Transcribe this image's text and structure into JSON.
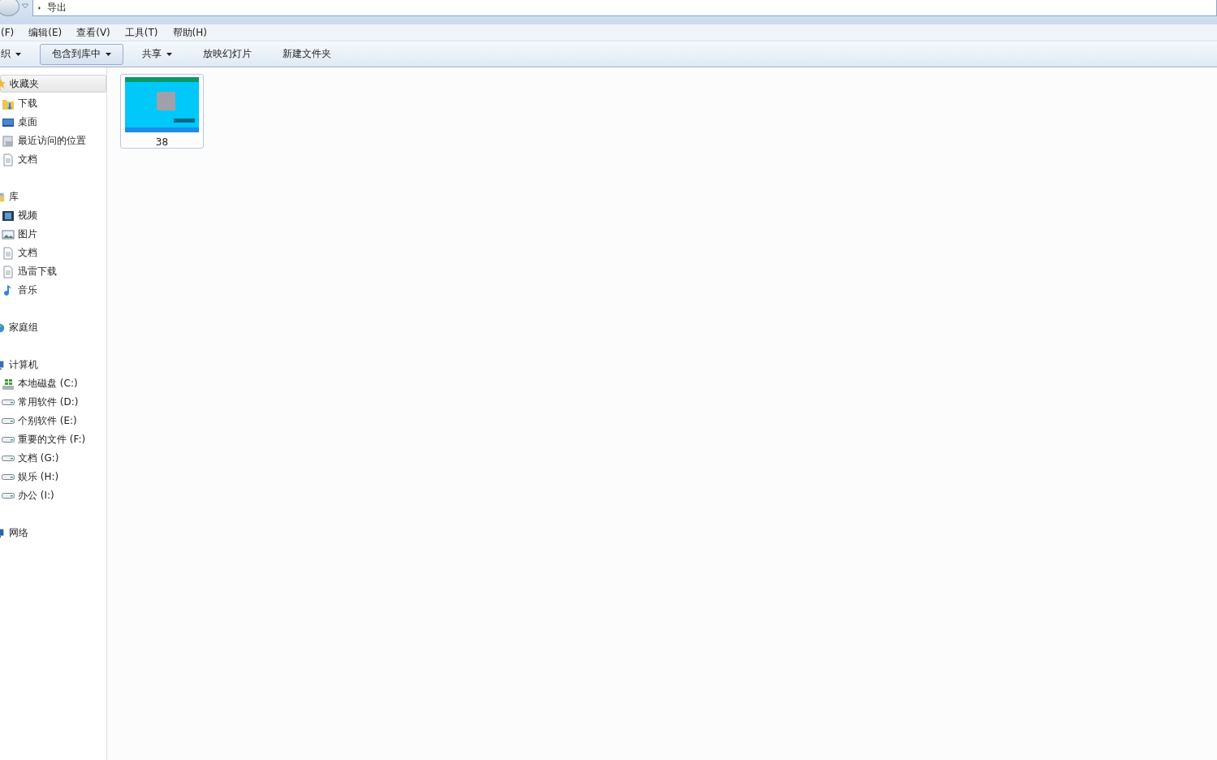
{
  "address_bar": {
    "path": [
      "导出"
    ]
  },
  "menu": [
    "(F)",
    "编辑(E)",
    "查看(V)",
    "工具(T)",
    "帮助(H)"
  ],
  "toolbar": [
    {
      "label": "织",
      "dropdown": true,
      "highlighted": false
    },
    {
      "label": "包含到库中",
      "dropdown": true,
      "highlighted": true
    },
    {
      "label": "共享",
      "dropdown": true,
      "highlighted": false
    },
    {
      "label": "放映幻灯片",
      "dropdown": false,
      "highlighted": false
    },
    {
      "label": "新建文件夹",
      "dropdown": false,
      "highlighted": false
    }
  ],
  "sidebar": {
    "groups": [
      {
        "label": "收藏夹",
        "kind": "star",
        "selected": true,
        "children": [
          {
            "label": "下载",
            "kind": "download-folder"
          },
          {
            "label": "桌面",
            "kind": "desktop"
          },
          {
            "label": "最近访问的位置",
            "kind": "recent"
          },
          {
            "label": "文档",
            "kind": "document"
          }
        ]
      },
      {
        "label": "库",
        "kind": "library",
        "selected": false,
        "children": [
          {
            "label": "视频",
            "kind": "video"
          },
          {
            "label": "图片",
            "kind": "picture"
          },
          {
            "label": "文档",
            "kind": "document"
          },
          {
            "label": "迅雷下载",
            "kind": "document"
          },
          {
            "label": "音乐",
            "kind": "music"
          }
        ]
      },
      {
        "label": "家庭组",
        "kind": "homegroup",
        "selected": false
      },
      {
        "label": "计算机",
        "kind": "computer",
        "selected": false,
        "children": [
          {
            "label": "本地磁盘 (C:)",
            "kind": "system-drive"
          },
          {
            "label": "常用软件 (D:)",
            "kind": "drive"
          },
          {
            "label": "个别软件 (E:)",
            "kind": "drive"
          },
          {
            "label": "重要的文件 (F:)",
            "kind": "drive"
          },
          {
            "label": "文档 (G:)",
            "kind": "drive"
          },
          {
            "label": "娱乐 (H:)",
            "kind": "drive"
          },
          {
            "label": "办公 (I:)",
            "kind": "drive"
          }
        ]
      },
      {
        "label": "网络",
        "kind": "network",
        "selected": false
      }
    ]
  },
  "files": [
    {
      "name": "38",
      "kind": "picture",
      "selected": true
    }
  ]
}
